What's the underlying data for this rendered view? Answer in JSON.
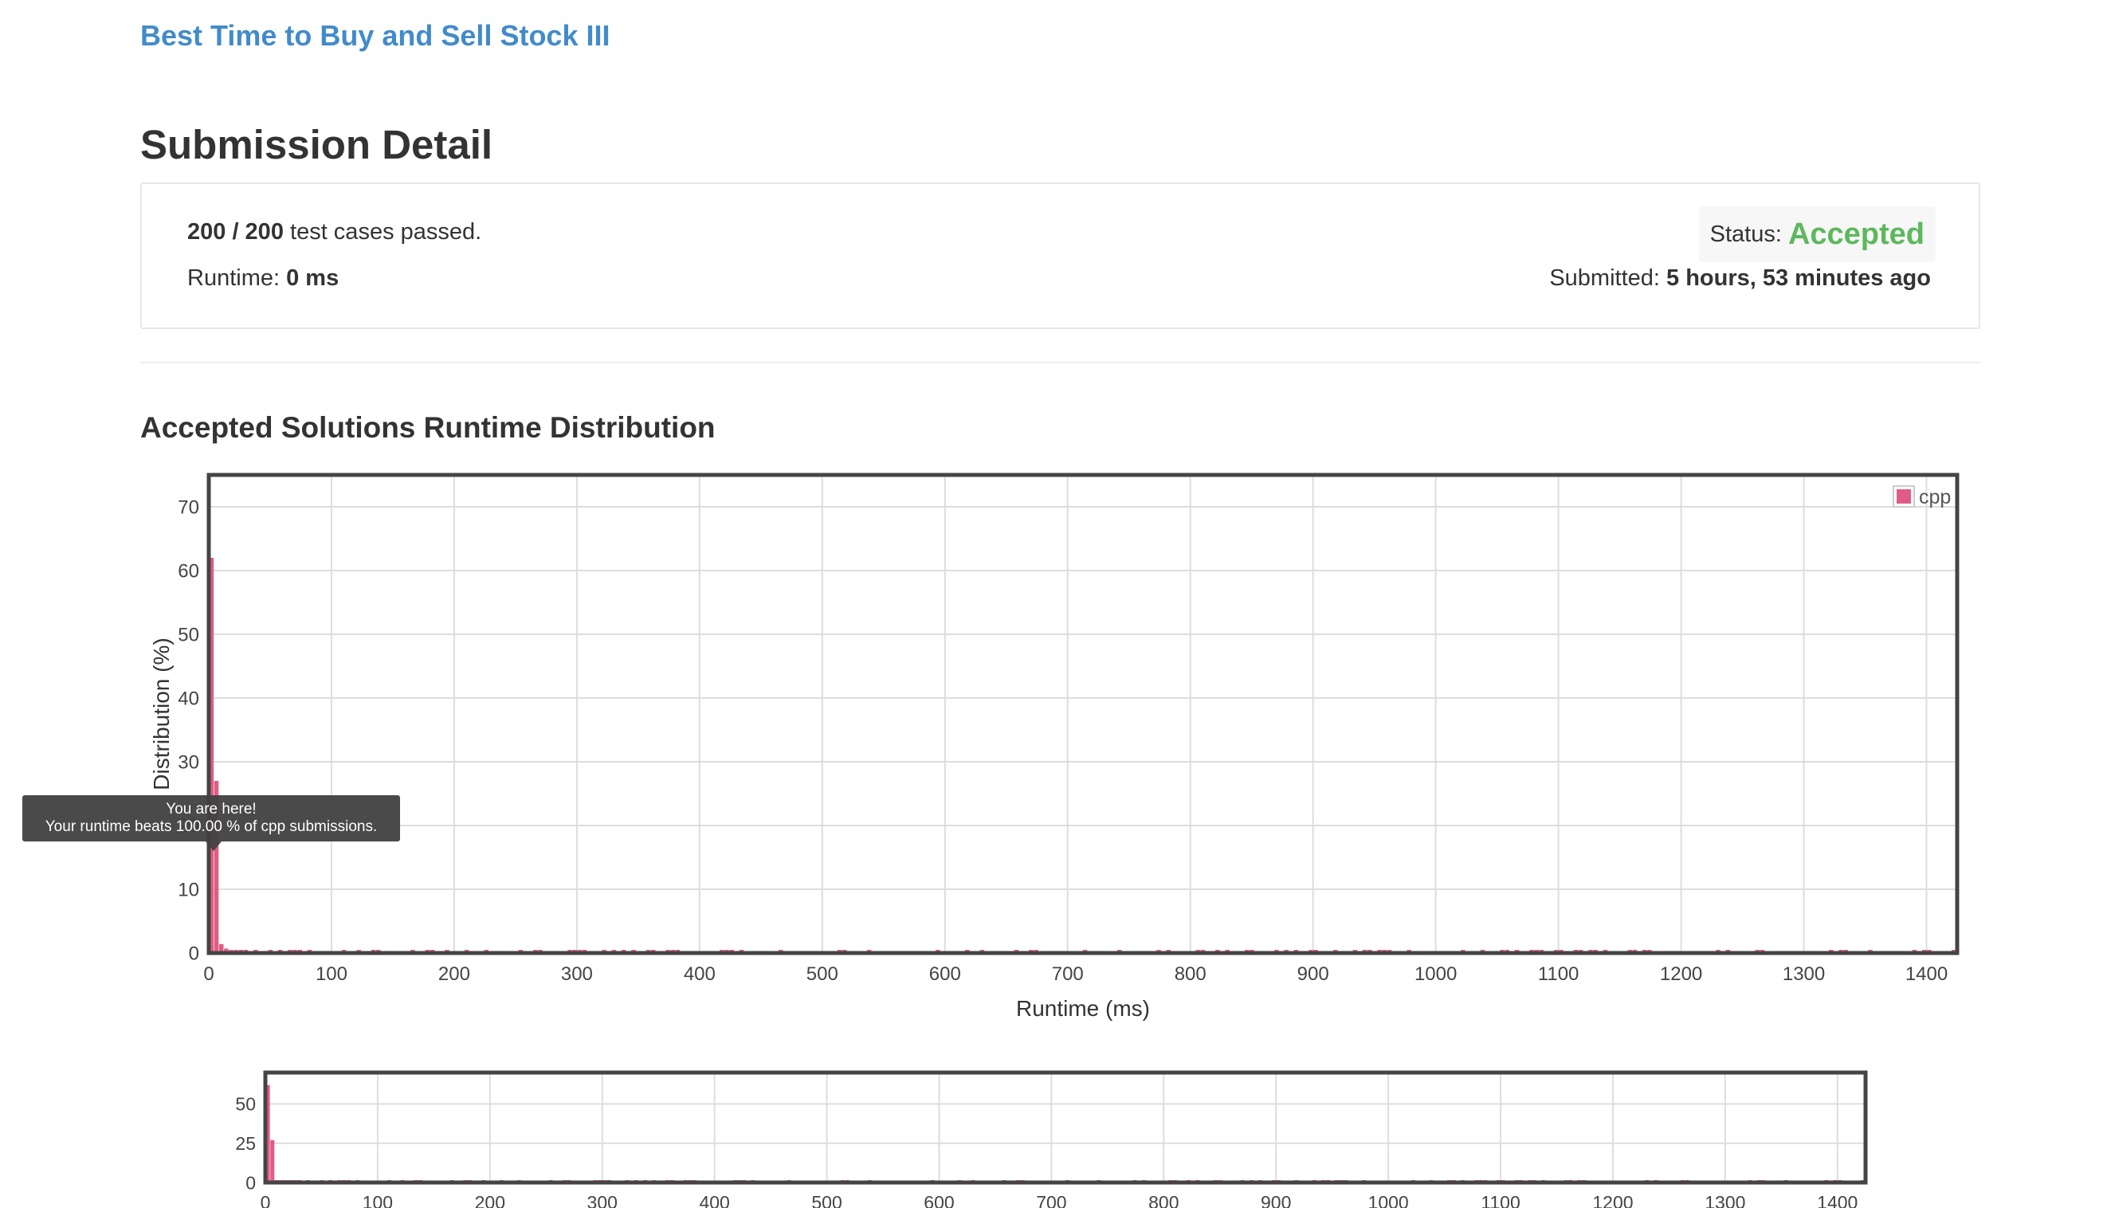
{
  "problem": {
    "title": "Best Time to Buy and Sell Stock III"
  },
  "page": {
    "title": "Submission Detail"
  },
  "result": {
    "passed_count": "200 / 200",
    "passed_suffix": " test cases passed.",
    "runtime_label": "Runtime: ",
    "runtime_value": "0 ms",
    "status_label": "Status: ",
    "status_value": "Accepted",
    "submitted_label": "Submitted: ",
    "submitted_value": "5 hours, 53 minutes ago"
  },
  "distribution": {
    "title": "Accepted Solutions Runtime Distribution"
  },
  "tooltip": {
    "line1": "You are here!",
    "line2": "Your runtime beats 100.00 % of cpp submissions."
  },
  "colors": {
    "link": "#428bca",
    "accepted": "#5cb85c",
    "bar": "#e05c84"
  },
  "chart_data": [
    {
      "type": "bar",
      "title": "",
      "xlabel": "Runtime (ms)",
      "ylabel": "Distribution (%)",
      "xlim": [
        0,
        1425
      ],
      "ylim": [
        0,
        75
      ],
      "xticks": [
        0,
        100,
        200,
        300,
        400,
        500,
        600,
        700,
        800,
        900,
        1000,
        1100,
        1200,
        1300,
        1400
      ],
      "yticks": [
        0,
        10,
        20,
        30,
        40,
        50,
        60,
        70
      ],
      "grid": true,
      "legend": "top-right",
      "series": [
        {
          "name": "cpp",
          "x": [
            4,
            8,
            12,
            16,
            20,
            24,
            28,
            32,
            40,
            52,
            60,
            68,
            72,
            76,
            84,
            112,
            124,
            136,
            140,
            168,
            180,
            184,
            196,
            212,
            228,
            256,
            268,
            272,
            296,
            300,
            304,
            308,
            324,
            332,
            340,
            348,
            360,
            364,
            376,
            380,
            384,
            420,
            424,
            428,
            436,
            468,
            516,
            520,
            540,
            596,
            620,
            632,
            660,
            672,
            676,
            716,
            744,
            776,
            784,
            808,
            812,
            824,
            832,
            848,
            852,
            872,
            880,
            888,
            900,
            904,
            920,
            936,
            944,
            948,
            956,
            960,
            964,
            980,
            1024,
            1040,
            1056,
            1060,
            1068,
            1080,
            1084,
            1088,
            1100,
            1104,
            1116,
            1120,
            1128,
            1132,
            1140,
            1160,
            1164,
            1172,
            1176,
            1232,
            1240,
            1264,
            1268,
            1324,
            1332,
            1336,
            1356,
            1392,
            1400,
            1404,
            1424
          ],
          "values": [
            62,
            27,
            1.4,
            0.7,
            0.5,
            0.4,
            0.4,
            0.3,
            0.2,
            0.2,
            0.2,
            0.3,
            0.3,
            0.2,
            0.2,
            0.2,
            0.2,
            0.3,
            0.3,
            0.2,
            0.2,
            0.2,
            0.2,
            0.2,
            0.2,
            0.2,
            0.2,
            0.2,
            0.2,
            0.2,
            0.2,
            0.2,
            0.2,
            0.2,
            0.2,
            0.2,
            0.2,
            0.2,
            0.2,
            0.2,
            0.2,
            0.2,
            0.2,
            0.2,
            0.2,
            0.2,
            0.2,
            0.2,
            0.2,
            0.2,
            0.2,
            0.2,
            0.2,
            0.2,
            0.2,
            0.2,
            0.2,
            0.2,
            0.2,
            0.2,
            0.2,
            0.2,
            0.2,
            0.2,
            0.2,
            0.2,
            0.2,
            0.2,
            0.2,
            0.2,
            0.2,
            0.2,
            0.2,
            0.2,
            0.2,
            0.2,
            0.2,
            0.2,
            0.2,
            0.2,
            0.2,
            0.2,
            0.2,
            0.2,
            0.2,
            0.2,
            0.2,
            0.2,
            0.2,
            0.2,
            0.2,
            0.2,
            0.2,
            0.2,
            0.2,
            0.2,
            0.2,
            0.2,
            0.2,
            0.2,
            0.2,
            0.2,
            0.2,
            0.2,
            0.2,
            0.2,
            0.2,
            0.2,
            0.5
          ]
        }
      ]
    },
    {
      "type": "bar",
      "title": "",
      "xlabel": "",
      "ylabel": "",
      "xlim": [
        0,
        1425
      ],
      "ylim": [
        0,
        70
      ],
      "xticks": [
        0,
        100,
        200,
        300,
        400,
        500,
        600,
        700,
        800,
        900,
        1000,
        1100,
        1200,
        1300,
        1400
      ],
      "yticks": [
        0,
        25,
        50
      ],
      "grid": true,
      "series": [
        {
          "ref": 0
        }
      ]
    }
  ]
}
